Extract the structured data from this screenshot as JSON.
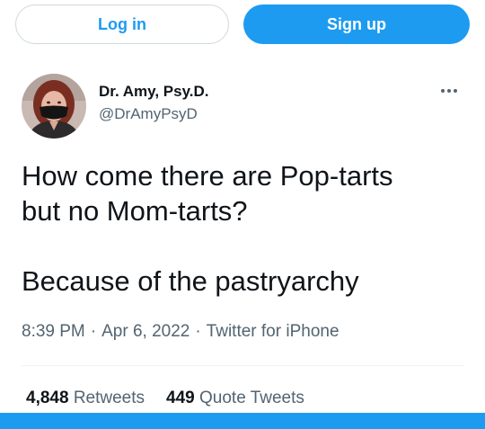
{
  "colors": {
    "accent": "#1d9bf0",
    "text_primary": "#0f1419",
    "text_secondary": "#536471",
    "border": "#cfd9de"
  },
  "auth": {
    "login_label": "Log in",
    "signup_label": "Sign up"
  },
  "tweet": {
    "author_name": "Dr. Amy, Psy.D.",
    "author_handle": "@DrAmyPsyD",
    "more_icon": "more-horizontal-icon",
    "text": "How come there are Pop-tarts\nbut no Mom-tarts?\n\nBecause of the pastryarchy",
    "time": "8:39 PM",
    "date": "Apr 6, 2022",
    "source": "Twitter for iPhone",
    "separator": "·"
  },
  "stats": {
    "retweets_count": "4,848",
    "retweets_label": "Retweets",
    "quotes_count": "449",
    "quotes_label": "Quote Tweets"
  }
}
